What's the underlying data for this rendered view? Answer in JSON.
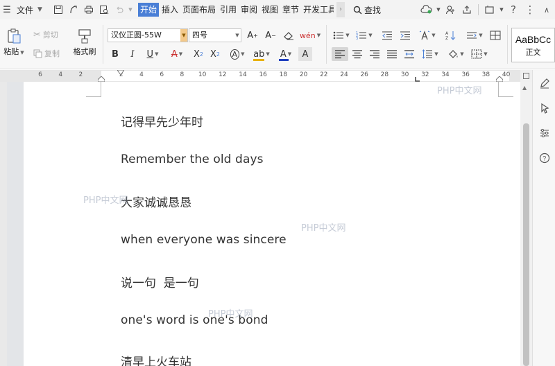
{
  "menubar": {
    "file_label": "文件",
    "tabs": [
      "开始",
      "插入",
      "页面布局",
      "引用",
      "审阅",
      "视图",
      "章节",
      "开发工具"
    ],
    "search_label": "查找"
  },
  "ribbon": {
    "paste_label": "粘贴",
    "cut_label": "剪切",
    "copy_label": "复制",
    "format_painter_label": "格式刷",
    "font_name": "汉仪正圆-55W",
    "font_size": "四号",
    "style_preview": "AaBbCc",
    "style_name": "正文"
  },
  "ruler": {
    "numbers": [
      "6",
      "4",
      "2",
      "",
      "2",
      "4",
      "6",
      "8",
      "10",
      "12",
      "14",
      "16",
      "18",
      "20",
      "22",
      "24",
      "26",
      "28",
      "30",
      "32",
      "34",
      "36",
      "38",
      "40"
    ]
  },
  "document": {
    "paragraphs": [
      "记得早先少年时",
      "Remember the old days",
      "大家诚诚恳恳",
      "when everyone was sincere",
      "说一句  是一句",
      "one's word is one's bond",
      "清早上火车站"
    ],
    "watermark": "PHP中文网"
  },
  "colors": {
    "active_tab": "#4a7fd6",
    "font_color_bar": "#1f3fbf",
    "highlight_bar": "#e8b100",
    "ruler_white": "#ffffff"
  }
}
